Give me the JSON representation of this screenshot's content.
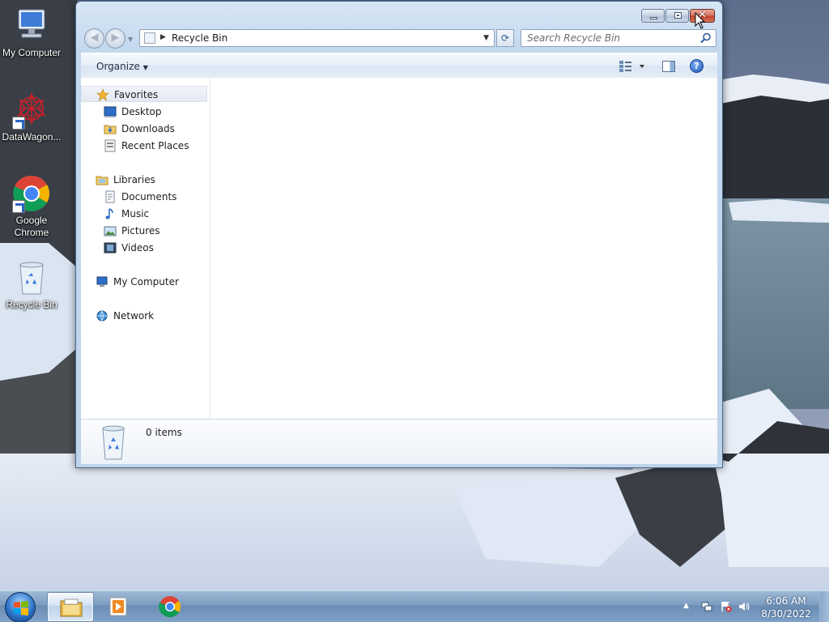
{
  "desktop": {
    "icons": [
      {
        "label": "My Computer",
        "icon": "computer-icon"
      },
      {
        "label": "DataWagon...",
        "icon": "datawagon-icon"
      },
      {
        "label": "Google Chrome",
        "icon": "chrome-icon"
      },
      {
        "label": "Recycle Bin",
        "icon": "recycle-bin-icon"
      }
    ]
  },
  "window": {
    "address": {
      "crumb": "Recycle Bin"
    },
    "search": {
      "placeholder": "Search Recycle Bin"
    },
    "toolbar": {
      "organize_label": "Organize"
    },
    "nav": {
      "favorites": {
        "label": "Favorites",
        "items": [
          "Desktop",
          "Downloads",
          "Recent Places"
        ]
      },
      "libraries": {
        "label": "Libraries",
        "items": [
          "Documents",
          "Music",
          "Pictures",
          "Videos"
        ]
      },
      "computer": {
        "label": "My Computer"
      },
      "network": {
        "label": "Network"
      }
    },
    "details": {
      "item_count": "0 items"
    }
  },
  "taskbar": {
    "pinned": [
      "windows-explorer-icon",
      "media-player-icon",
      "chrome-icon"
    ],
    "clock": {
      "time": "6:06 AM",
      "date": "8/30/2022"
    }
  },
  "colors": {
    "taskbar": "#7c9cc0",
    "window_frame": "#c4d8ee",
    "close_button": "#c4412b"
  }
}
